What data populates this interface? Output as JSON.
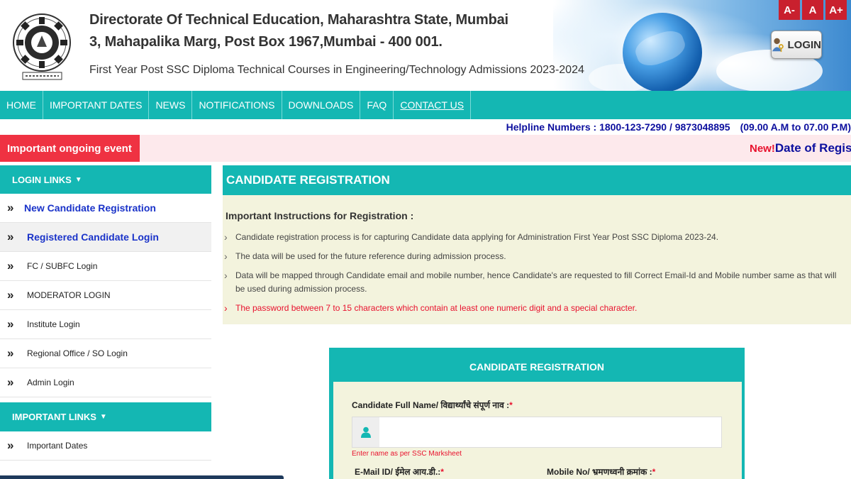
{
  "header": {
    "title_line1": "Directorate Of Technical Education, Maharashtra State, Mumbai",
    "title_line2": "3, Mahapalika Marg, Post Box 1967,Mumbai - 400 001.",
    "subtitle": "First Year Post SSC Diploma Technical Courses in Engineering/Technology Admissions 2023-2024",
    "font_buttons": [
      "A-",
      "A",
      "A+"
    ],
    "login_label": "LOGIN"
  },
  "nav": {
    "items": [
      "HOME",
      "IMPORTANT DATES",
      "NEWS",
      "NOTIFICATIONS",
      "DOWNLOADS",
      "FAQ",
      "CONTACT US"
    ]
  },
  "helpline": {
    "numbers": "Helpline Numbers : 1800-123-7290 / 9873048895",
    "hours": "(09.00 A.M to 07.00 P.M)"
  },
  "ongoing": {
    "label": "Important ongoing event",
    "ticker_new": "New!",
    "ticker_text": "Date of Regist"
  },
  "sidebar": {
    "login_links_heading": "LOGIN LINKS",
    "login_links": [
      "New Candidate Registration",
      "Registered Candidate Login",
      "FC / SUBFC Login",
      "MODERATOR LOGIN",
      "Institute Login",
      "Regional Office / SO Login",
      "Admin Login"
    ],
    "important_links_heading": "IMPORTANT LINKS",
    "important_links": [
      "Important Dates"
    ]
  },
  "main": {
    "heading": "CANDIDATE REGISTRATION",
    "instructions_title": "Important Instructions for Registration :",
    "instructions": [
      "Candidate registration process is for capturing Candidate data applying for Administration First Year Post SSC Diploma 2023-24.",
      "The data will be used for the future reference during admission process.",
      "Data will be mapped through Candidate email and mobile number, hence Candidate's are requested to fill Correct Email-Id and Mobile number same as that will be used during admission process.",
      "The password between 7 to 15 characters which contain at least one numeric digit and a special character."
    ]
  },
  "form": {
    "title": "CANDIDATE REGISTRATION",
    "full_name_label": "Candidate Full Name/ विद्यार्थ्यांचे संपूर्ण नाव :",
    "full_name_value": "",
    "full_name_hint": "Enter name as per SSC Marksheet",
    "email_label": "E-Mail ID/ ईमेल आय.डी.:",
    "mobile_label": "Mobile No/ भ्रमणध्वनी क्रमांक :",
    "required_mark": "*"
  },
  "colors": {
    "teal": "#14b7b3",
    "red": "#ef3242",
    "navy_text": "#0c0f9e",
    "instruction_bg": "#f3f3dd"
  }
}
